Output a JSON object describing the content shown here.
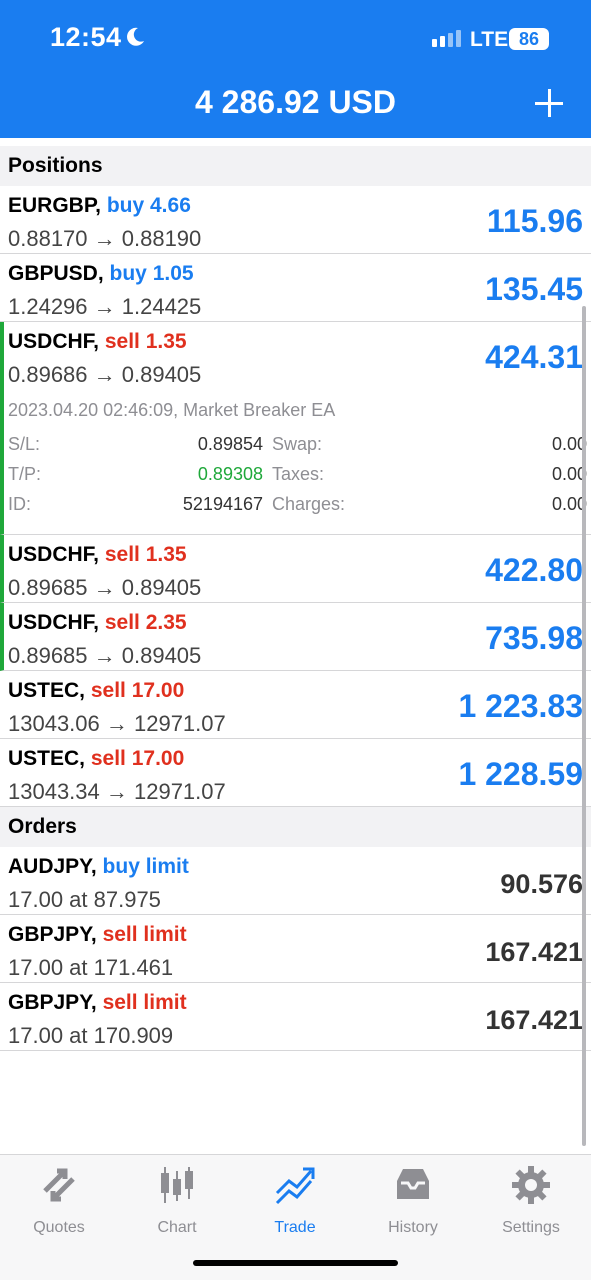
{
  "status": {
    "time": "12:54",
    "network": "LTE",
    "battery": "86"
  },
  "header": {
    "balance": "4 286.92 USD"
  },
  "positions_title": "Positions",
  "positions": [
    {
      "symbol": "EURGBP,",
      "side": "buy 4.66",
      "prices": "0.88170 → 0.88190",
      "profit": "115.96"
    },
    {
      "symbol": "GBPUSD,",
      "side": "buy 1.05",
      "prices": "1.24296 → 1.24425",
      "profit": "135.45"
    },
    {
      "symbol": "USDCHF,",
      "side": "sell 1.35",
      "prices": "0.89686 → 0.89405",
      "profit": "424.31"
    },
    {
      "symbol": "USDCHF,",
      "side": "sell 1.35",
      "prices": "0.89685 → 0.89405",
      "profit": "422.80"
    },
    {
      "symbol": "USDCHF,",
      "side": "sell 2.35",
      "prices": "0.89685 → 0.89405",
      "profit": "735.98"
    },
    {
      "symbol": "USTEC,",
      "side": "sell 17.00",
      "prices": "13043.06 → 12971.07",
      "profit": "1 223.83"
    },
    {
      "symbol": "USTEC,",
      "side": "sell 17.00",
      "prices": "13043.34 → 12971.07",
      "profit": "1 228.59"
    }
  ],
  "details": {
    "date": "2023.04.20 02:46:09, Market Breaker EA",
    "sl_label": "S/L:",
    "sl_value": "0.89854",
    "tp_label": "T/P:",
    "tp_value": "0.89308",
    "id_label": "ID:",
    "id_value": "52194167",
    "swap_label": "Swap:",
    "swap_value": "0.00",
    "taxes_label": "Taxes:",
    "taxes_value": "0.00",
    "charges_label": "Charges:",
    "charges_value": "0.00"
  },
  "orders_title": "Orders",
  "orders": [
    {
      "symbol": "AUDJPY,",
      "type": "buy limit",
      "detail": "17.00 at 87.975",
      "price": "90.576"
    },
    {
      "symbol": "GBPJPY,",
      "type": "sell limit",
      "detail": "17.00 at 171.461",
      "price": "167.421"
    },
    {
      "symbol": "GBPJPY,",
      "type": "sell limit",
      "detail": "17.00 at 170.909",
      "price": "167.421"
    }
  ],
  "tabs": [
    {
      "label": "Quotes",
      "icon": "quotes-icon"
    },
    {
      "label": "Chart",
      "icon": "chart-icon"
    },
    {
      "label": "Trade",
      "icon": "trade-icon"
    },
    {
      "label": "History",
      "icon": "history-icon"
    },
    {
      "label": "Settings",
      "icon": "gear-icon"
    }
  ],
  "colors": {
    "accent": "#1a7df0",
    "sell": "#e0301e",
    "green": "#1fa83a"
  }
}
